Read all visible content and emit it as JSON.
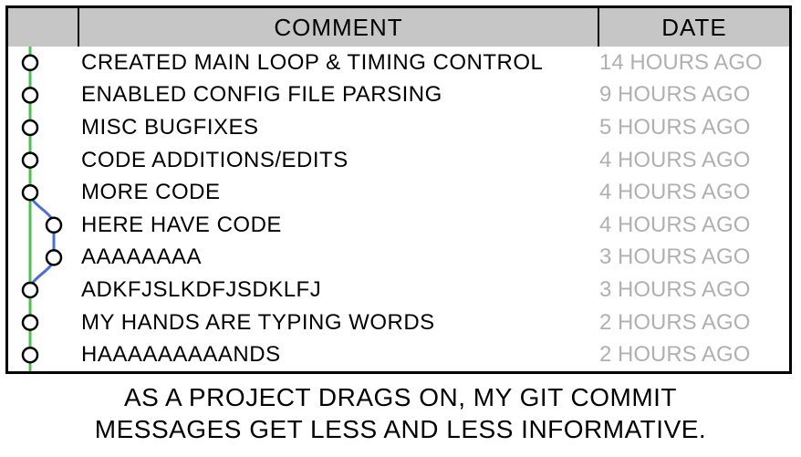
{
  "header": {
    "comment": "COMMENT",
    "date": "DATE"
  },
  "commits": [
    {
      "msg": "CREATED MAIN LOOP & TIMING CONTROL",
      "date": "14 HOURS AGO",
      "lane": 0
    },
    {
      "msg": "ENABLED CONFIG FILE PARSING",
      "date": "9 HOURS AGO",
      "lane": 0
    },
    {
      "msg": "MISC BUGFIXES",
      "date": "5 HOURS AGO",
      "lane": 0
    },
    {
      "msg": "CODE ADDITIONS/EDITS",
      "date": "4 HOURS AGO",
      "lane": 0
    },
    {
      "msg": "MORE CODE",
      "date": "4 HOURS AGO",
      "lane": 0
    },
    {
      "msg": "HERE HAVE CODE",
      "date": "4 HOURS AGO",
      "lane": 1
    },
    {
      "msg": "AAAAAAAA",
      "date": "3 HOURS AGO",
      "lane": 1
    },
    {
      "msg": "ADKFJSLKDFJSDKLFJ",
      "date": "3 HOURS AGO",
      "lane": 0
    },
    {
      "msg": "MY HANDS ARE TYPING WORDS",
      "date": "2 HOURS AGO",
      "lane": 0
    },
    {
      "msg": "HAAAAAAAAANDS",
      "date": "2 HOURS AGO",
      "lane": 0
    }
  ],
  "caption": {
    "line1": "AS A PROJECT DRAGS ON, MY GIT COMMIT",
    "line2": "MESSAGES GET LESS AND LESS INFORMATIVE."
  },
  "graph": {
    "lane_x": [
      24,
      50
    ],
    "row_h": 35.6,
    "node_r": 8,
    "colors": {
      "main": "#4cc24c",
      "branch": "#4a6fd6",
      "node_stroke": "#000",
      "node_fill": "#fff"
    }
  }
}
